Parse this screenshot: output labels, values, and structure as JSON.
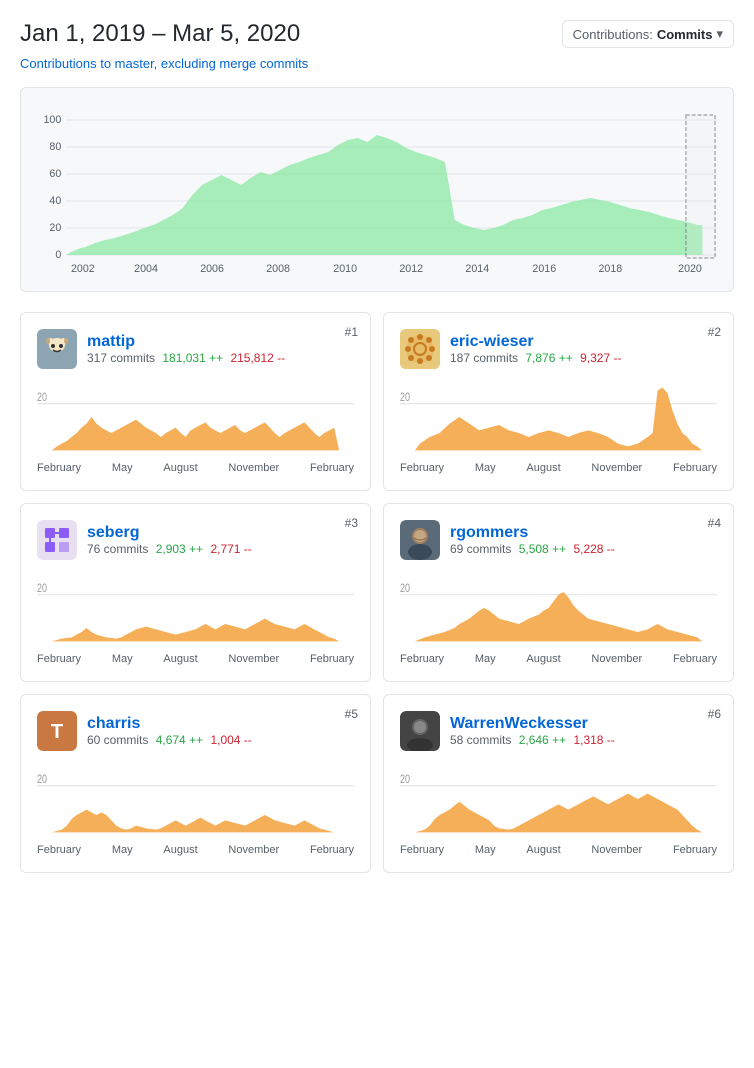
{
  "header": {
    "date_range": "Jan 1, 2019 – Mar 5, 2020",
    "dropdown_label": "Contributions: ",
    "dropdown_value": "Commits",
    "dropdown_icon": "▾"
  },
  "subtitle": "Contributions to master, excluding merge commits",
  "contributors": [
    {
      "rank": "#1",
      "name": "mattip",
      "commits": "317 commits",
      "additions": "181,031 ++",
      "deletions": "215,812 --",
      "avatar_color": "#6f8fa1",
      "avatar_emoji": "🐱"
    },
    {
      "rank": "#2",
      "name": "eric-wieser",
      "commits": "187 commits",
      "additions": "7,876 ++",
      "deletions": "9,327 --",
      "avatar_color": "#e8a63a",
      "avatar_emoji": "✿"
    },
    {
      "rank": "#3",
      "name": "seberg",
      "commits": "76 commits",
      "additions": "2,903 ++",
      "deletions": "2,771 --",
      "avatar_color": "#8b5cf6",
      "avatar_emoji": "❊"
    },
    {
      "rank": "#4",
      "name": "rgommers",
      "commits": "69 commits",
      "additions": "5,508 ++",
      "deletions": "5,228 --",
      "avatar_color": "#6f8fa1",
      "avatar_emoji": "👤"
    },
    {
      "rank": "#5",
      "name": "charris",
      "commits": "60 commits",
      "additions": "4,674 ++",
      "deletions": "1,004 --",
      "avatar_color": "#d97c4a",
      "avatar_emoji": "T"
    },
    {
      "rank": "#6",
      "name": "WarrenWeckesser",
      "commits": "58 commits",
      "additions": "2,646 ++",
      "deletions": "1,318 --",
      "avatar_color": "#333",
      "avatar_emoji": "👤"
    }
  ],
  "chart_x_labels_main": [
    "2002",
    "2004",
    "2006",
    "2008",
    "2010",
    "2012",
    "2014",
    "2016",
    "2018",
    "2020"
  ],
  "chart_y_labels_main": [
    "100",
    "80",
    "60",
    "40",
    "20",
    "0"
  ],
  "chart_x_labels_mini": [
    "February",
    "May",
    "August",
    "November",
    "February"
  ]
}
